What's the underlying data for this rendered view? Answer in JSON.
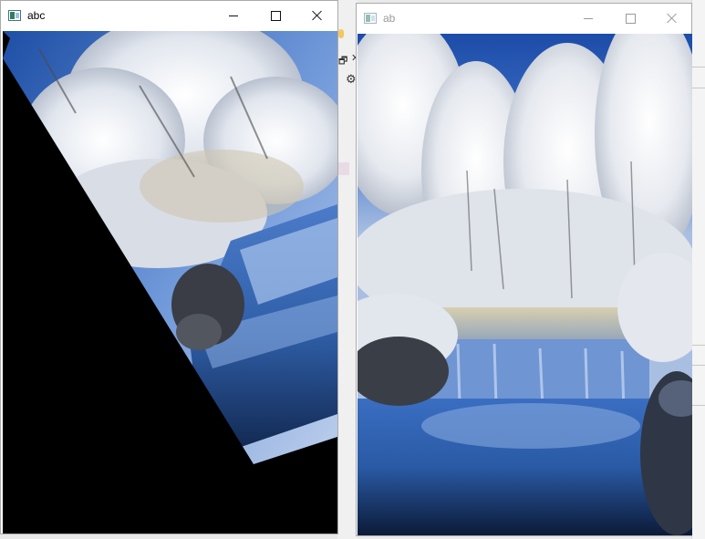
{
  "windows": {
    "left": {
      "title": "abc",
      "state": "active",
      "image": "rotated-winter-waterfall"
    },
    "right": {
      "title": "ab",
      "state": "inactive",
      "image": "winter-waterfall"
    }
  },
  "controls": {
    "minimize": "minimize-icon",
    "maximize": "maximize-icon",
    "close": "close-icon"
  },
  "colors": {
    "sky": "#2a5fb8",
    "frost": "#e9ecf2",
    "water": "#2f66b8",
    "rotation_fill": "#000000"
  }
}
